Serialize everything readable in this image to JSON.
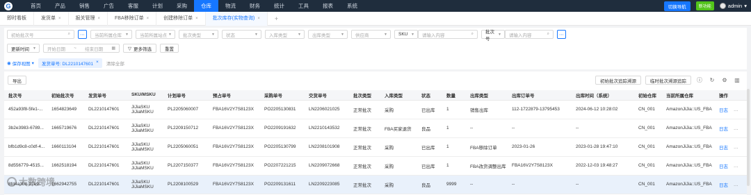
{
  "brand": {
    "logo_letter": "G"
  },
  "nav": {
    "items": [
      "首页",
      "产品",
      "销售",
      "广告",
      "客服",
      "计划",
      "采购",
      "仓库",
      "物流",
      "财务",
      "统计",
      "工具",
      "报表",
      "系统"
    ],
    "active_index": 7,
    "switch_label": "切换导航",
    "new_label": "新功能",
    "user": "admin"
  },
  "tabs": [
    {
      "label": "即时看板"
    },
    {
      "label": "发货单"
    },
    {
      "label": "报关管理"
    },
    {
      "label": "FBA移除订单"
    },
    {
      "label": "创建移除订单"
    },
    {
      "label": "批次库存(实物查询)"
    }
  ],
  "tab_active_index": 5,
  "filters": {
    "row1": [
      {
        "placeholder": "初始批次号",
        "width": 97,
        "icon": "search-icon"
      },
      {
        "placeholder": "当前所属仓库",
        "width": 60,
        "icon": "chevron-down-icon"
      },
      {
        "placeholder": "当前所属站点",
        "width": 57,
        "icon": "chevron-down-icon"
      },
      {
        "placeholder": "批次类型",
        "width": 57,
        "icon": "chevron-down-icon"
      },
      {
        "placeholder": "状态",
        "width": 57,
        "icon": "chevron-down-icon"
      },
      {
        "placeholder": "入库类型",
        "width": 57,
        "icon": "chevron-down-icon"
      },
      {
        "placeholder": "出库类型",
        "width": 57,
        "icon": "chevron-down-icon"
      },
      {
        "placeholder": "供应商",
        "width": 57,
        "icon": "chevron-down-icon"
      }
    ],
    "sku_select": "SKU",
    "sku_placeholder": "请输入内容",
    "batch_select": "批次号",
    "batch_placeholder": "请输入内容",
    "time_select": "更新时间",
    "start_date": "开始日期",
    "end_date": "结束日期",
    "more_filter": "更多筛选",
    "reset": "重置",
    "save_view": "保存视图",
    "chip": "发货单号: DL2210147601",
    "clear_all": "清除全部"
  },
  "actions": {
    "export": "导出",
    "init_trace": "初始批次追踪溯源",
    "temp_trace": "临时批次溯源追踪"
  },
  "table": {
    "headers": [
      "批次号",
      "初始批次号",
      "发货单号",
      "SKU/MSKU",
      "计划单号",
      "预占单号",
      "采购单号",
      "交货单号",
      "批次类型",
      "入库类型",
      "状态",
      "数量",
      "出库类型",
      "出库订单号",
      "出库时间（系统）",
      "初始仓库",
      "当前所属仓库",
      "操作"
    ],
    "rows": [
      {
        "c": [
          "452a93f8-5fe1-...",
          "1654823649",
          "DL2210147601",
          "JiJiaSKU\nJiJiaMSKU",
          "PL2205060007",
          "FBA16V2Y7S8123X",
          "PO2205130831",
          "LN2206021025",
          "正常批次",
          "采购",
          "已出库",
          "1",
          "销售出库",
          "112-1722879-13795453",
          "2024-06-12 10:28:02",
          "CN_001",
          "AmazonJiJia::US_FBA"
        ]
      },
      {
        "c": [
          "3b2e3983-6789...",
          "1665719676",
          "DL2210147601",
          "JiJiaSKU\nJiJiaMSKU",
          "PL2209150712",
          "FBA16V2Y7S8123X",
          "PO2209191632",
          "LN2210143532",
          "正常批次",
          "FBA买家退货",
          "良品",
          "1",
          "--",
          "--",
          "--",
          "CN_001",
          "AmazonJiJia::US_FBA"
        ]
      },
      {
        "c": [
          "bfb1d9c8-c0df-4...",
          "1660113104",
          "DL2210147601",
          "JiJiaSKU\nJiJiaMSKU",
          "PL2205060051",
          "FBA16V2Y7S8123X",
          "PO2205130799",
          "LN2208101908",
          "正常批次",
          "采购",
          "已出库",
          "1",
          "FBA移除订单",
          "2023-01-26",
          "2023-01-28 19:47:10",
          "CN_001",
          "AmazonJiJia::US_FBA"
        ]
      },
      {
        "c": [
          "8d556779-4515...",
          "1662518194",
          "DL2210147601",
          "JiJiaSKU\nJiJiaMSKU",
          "PL2207150377",
          "FBA16V2Y7S8123X",
          "PO2207221215",
          "LN2209072668",
          "正常批次",
          "采购",
          "已出库",
          "1",
          "FBA改货调整出库",
          "FBA16V2Y7S8123X",
          "2022-12-03 19:48:27",
          "CN_001",
          "AmazonJiJia::US_FBA"
        ]
      },
      {
        "c": [
          "8fd4a3b8-27e9...",
          "1662942755",
          "DL2210147601",
          "JiJiaSKU\nJiJiaMSKU",
          "PL2208100529",
          "FBA16V2Y7S8123X",
          "PO2209131611",
          "LN2209223085",
          "正常批次",
          "采购",
          "良品",
          "9999",
          "--",
          "--",
          "--",
          "CN_001",
          "AmazonJiJia::US_FBA"
        ]
      }
    ],
    "op_log": "日志",
    "op_more": "···",
    "selected_row": 4
  },
  "watermark": "大数跨境"
}
